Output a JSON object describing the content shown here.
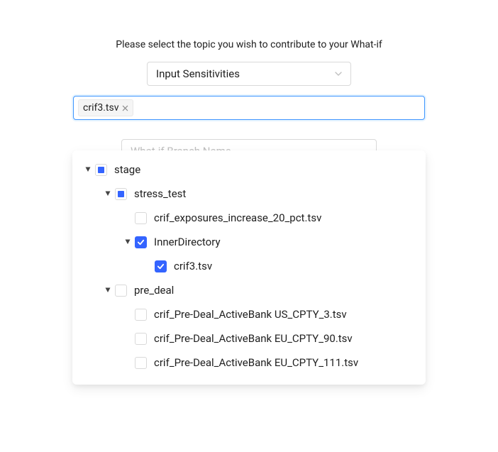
{
  "instruction": "Please select the topic you wish to contribute to your What-if",
  "topic_select": {
    "value": "Input Sensitivities"
  },
  "tag_input": {
    "tags": [
      {
        "label": "crif3.tsv"
      }
    ]
  },
  "branch_placeholder": "What-if Branch Name",
  "tree": {
    "nodes": [
      {
        "label": "stage",
        "level": 0,
        "state": "indeterminate",
        "expanded": true,
        "leaf": false
      },
      {
        "label": "stress_test",
        "level": 1,
        "state": "indeterminate",
        "expanded": true,
        "leaf": false
      },
      {
        "label": "crif_exposures_increase_20_pct.tsv",
        "level": 2,
        "state": "unchecked",
        "expanded": false,
        "leaf": true
      },
      {
        "label": "InnerDirectory",
        "level": 2,
        "state": "checked",
        "expanded": true,
        "leaf": false
      },
      {
        "label": "crif3.tsv",
        "level": 3,
        "state": "checked",
        "expanded": false,
        "leaf": true
      },
      {
        "label": "pre_deal",
        "level": 1,
        "state": "unchecked",
        "expanded": true,
        "leaf": false
      },
      {
        "label": "crif_Pre-Deal_ActiveBank US_CPTY_3.tsv",
        "level": 2,
        "state": "unchecked",
        "expanded": false,
        "leaf": true
      },
      {
        "label": "crif_Pre-Deal_ActiveBank EU_CPTY_90.tsv",
        "level": 2,
        "state": "unchecked",
        "expanded": false,
        "leaf": true
      },
      {
        "label": "crif_Pre-Deal_ActiveBank EU_CPTY_111.tsv",
        "level": 2,
        "state": "unchecked",
        "expanded": false,
        "leaf": true
      }
    ]
  }
}
